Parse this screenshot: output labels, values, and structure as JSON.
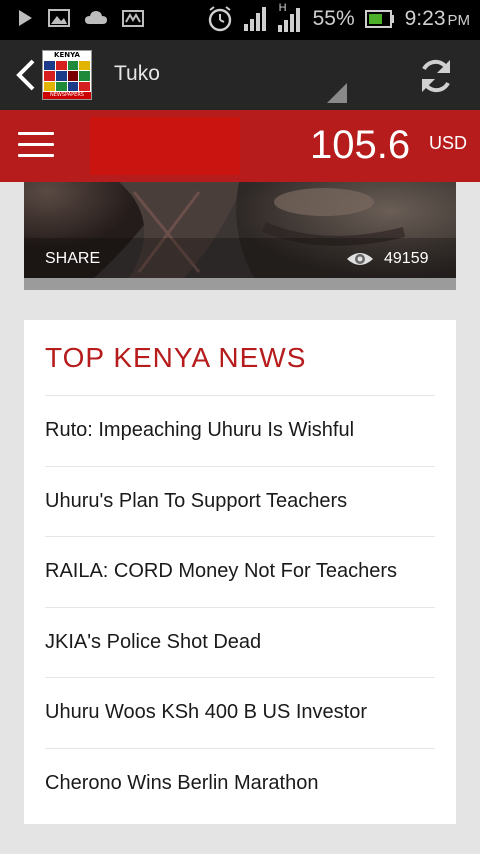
{
  "status_bar": {
    "battery_percent": "55%",
    "time": "9:23",
    "meridiem": "PM",
    "network_type": "H",
    "icons": [
      "play-icon",
      "image-icon",
      "cloud-icon",
      "mail-icon",
      "alarm-icon",
      "signal-icon",
      "signal-h-icon",
      "battery-icon"
    ]
  },
  "action_bar": {
    "title": "Tuko",
    "logo_top": "KENYA",
    "logo_bottom": "NEWSPAPERS",
    "icons": [
      "back-icon",
      "refresh-icon"
    ]
  },
  "toolbar": {
    "rate_value": "105.6",
    "rate_currency": "USD",
    "colors": {
      "toolbar": "#b71c1c",
      "ad": "#c9140f"
    }
  },
  "hero": {
    "share_label": "SHARE",
    "views": "49159"
  },
  "news": {
    "heading": "TOP KENYA NEWS",
    "items": [
      "Ruto: Impeaching Uhuru Is Wishful",
      "Uhuru's Plan To Support Teachers",
      "RAILA: CORD Money Not For Teachers",
      "JKIA's Police Shot Dead",
      "Uhuru Woos KSh 400 B US Investor",
      "Cherono Wins Berlin Marathon"
    ],
    "accent_color": "#b71c1c"
  }
}
